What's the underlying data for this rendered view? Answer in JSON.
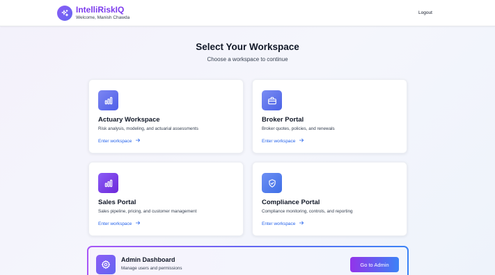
{
  "header": {
    "title": "IntelliRiskIQ",
    "welcome": "Welcome, Manish Chawda",
    "logout_label": "Logout",
    "logo_icon": "sparkles-icon"
  },
  "main": {
    "title": "Select Your Workspace",
    "subtitle": "Choose a workspace to continue"
  },
  "workspaces": [
    {
      "title": "Actuary Workspace",
      "description": "Risk analysis, modeling, and actuarial assessments",
      "link_label": "Enter workspace",
      "icon": "bar-chart-icon",
      "icon_color": "#6b73f0"
    },
    {
      "title": "Broker Portal",
      "description": "Broker quotes, policies, and renewals",
      "link_label": "Enter workspace",
      "icon": "briefcase-icon",
      "icon_color": "#5b6ef0"
    },
    {
      "title": "Sales Portal",
      "description": "Sales pipeline, pricing, and customer management",
      "link_label": "Enter workspace",
      "icon": "bar-chart-icon",
      "icon_color": "#7c3aed"
    },
    {
      "title": "Compliance Portal",
      "description": "Compliance monitoring, controls, and reporting",
      "link_label": "Enter workspace",
      "icon": "shield-check-icon",
      "icon_color": "#4f7cf0"
    }
  ],
  "admin": {
    "title": "Admin Dashboard",
    "description": "Manage users and permissions",
    "button_label": "Go to Admin",
    "icon": "gear-icon"
  },
  "colors": {
    "brand": "#7c3aed",
    "link": "#2563eb",
    "accent_gradient_start": "#9333ea",
    "accent_gradient_end": "#3b82f6"
  }
}
